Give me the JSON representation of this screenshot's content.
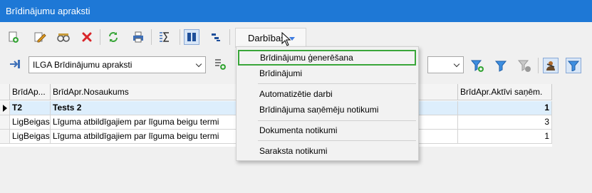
{
  "window": {
    "title": "Brīdinājumu apraksti"
  },
  "toolbar": {
    "icons": [
      "add-icon",
      "edit-icon",
      "view-icon",
      "delete-icon",
      "refresh-icon",
      "print-icon",
      "sum-icon",
      "columns-icon",
      "tree-icon"
    ],
    "actions_label": "Darbības"
  },
  "filter": {
    "selected": "ILGA Brīdinājumu apraksti"
  },
  "grid": {
    "columns": [
      "BrīdAp...",
      "BrīdApr.Nosaukums",
      "BrīdApr.Aktīvi saņēm."
    ],
    "rows": [
      {
        "code": "T2",
        "name": "Tests 2",
        "active": "1",
        "selected": true
      },
      {
        "code": "LigBeigas",
        "name": "Līguma atbildīgajiem par līguma beigu termi",
        "active": "3",
        "selected": false
      },
      {
        "code": "LigBeigas",
        "name": "Līguma atbildīgajiem par līguma beigu termi",
        "active": "1",
        "selected": false
      }
    ]
  },
  "menu": {
    "items": [
      "Brīdinājumu ģenerēšana",
      "Brīdinājumi",
      "Automatizētie darbi",
      "Brīdinājuma saņēmēju notikumi",
      "Dokumenta notikumi",
      "Saraksta notikumi"
    ],
    "highlight_color": "#3aa63a"
  },
  "colors": {
    "titlebar": "#1e78d6",
    "selected_row": "#ddeefc"
  }
}
